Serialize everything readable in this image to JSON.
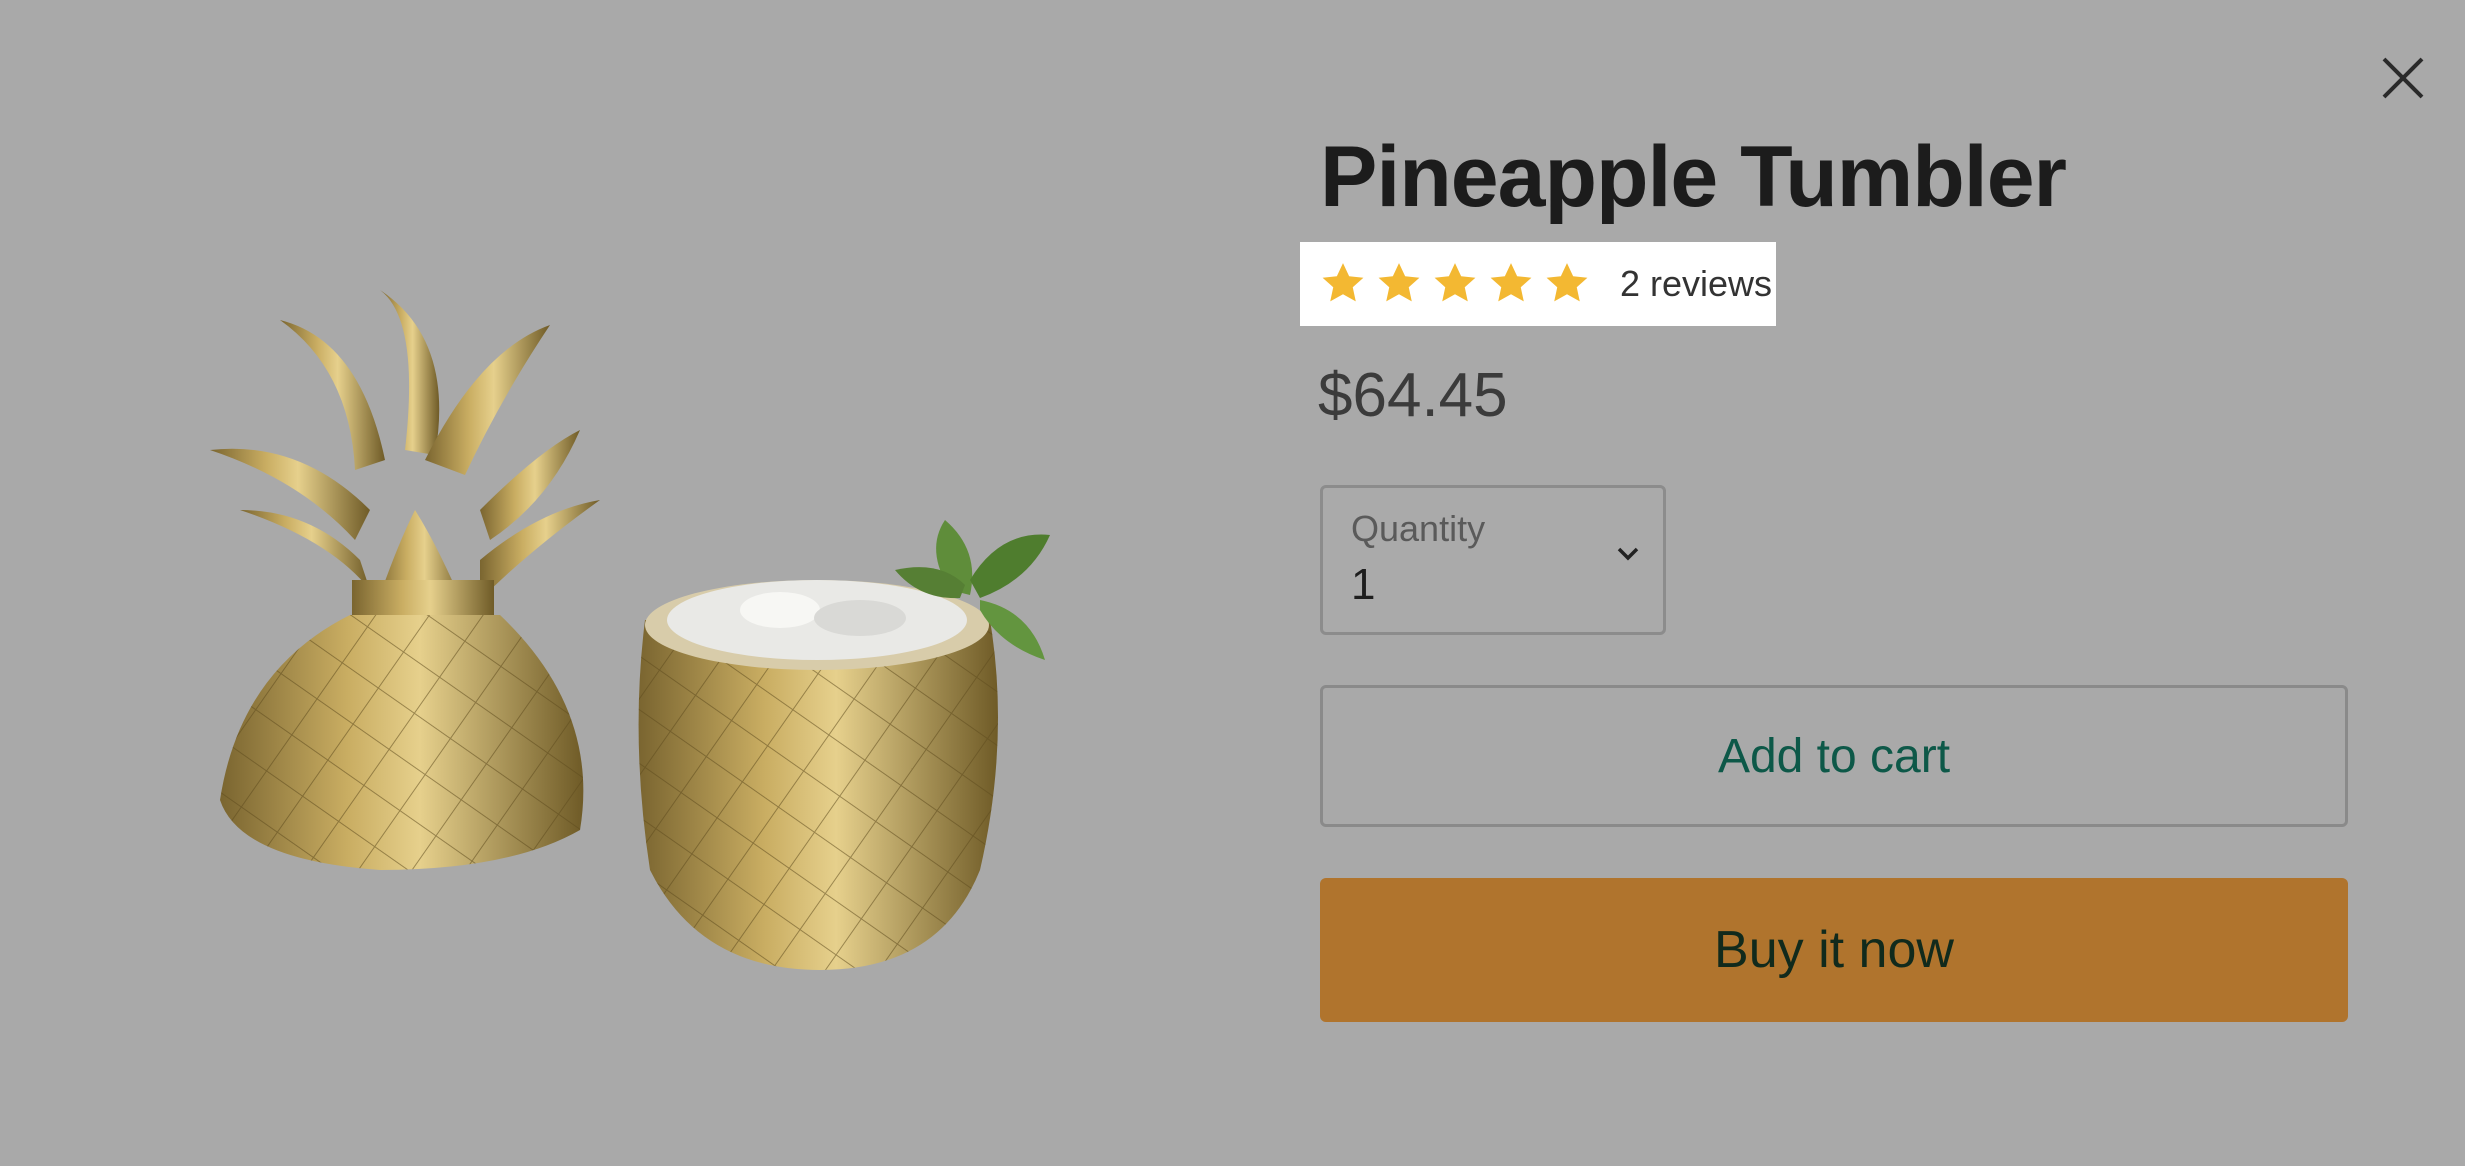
{
  "product": {
    "title": "Pineapple Tumbler",
    "rating": {
      "stars": 5,
      "max": 5,
      "reviews_label": "2 reviews"
    },
    "price": "$64.45",
    "quantity": {
      "label": "Quantity",
      "value": "1"
    },
    "add_to_cart_label": "Add to cart",
    "buy_now_label": "Buy it now"
  },
  "icons": {
    "close": "close-icon",
    "star": "star-icon",
    "chevron": "chevron-down-icon"
  },
  "colors": {
    "overlay_background": "#a9a9a9",
    "star": "#f3b832",
    "buy_button": "#b0742d",
    "add_to_cart_text": "#0d5848"
  }
}
